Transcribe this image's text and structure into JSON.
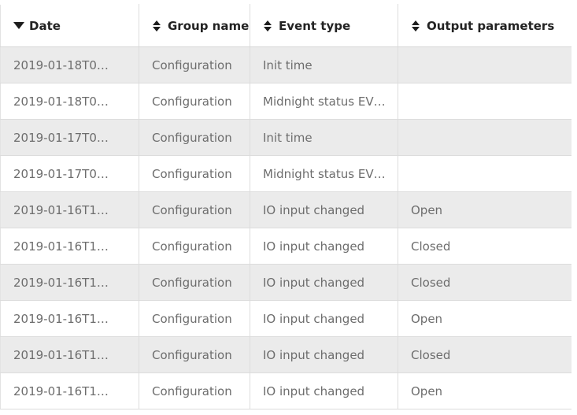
{
  "table": {
    "columns": [
      {
        "label": "Date",
        "sort": "desc",
        "icon": "sort-descending-icon"
      },
      {
        "label": "Group name",
        "sort": "none",
        "icon": "sort-none-icon"
      },
      {
        "label": "Event type",
        "sort": "none",
        "icon": "sort-none-icon"
      },
      {
        "label": "Output parameters",
        "sort": "none",
        "icon": "sort-none-icon"
      }
    ],
    "rows": [
      {
        "date": "2019-01-18T0…",
        "group": "Configuration",
        "event": "Init time",
        "output": ""
      },
      {
        "date": "2019-01-18T0…",
        "group": "Configuration",
        "event": "Midnight status EV…",
        "output": ""
      },
      {
        "date": "2019-01-17T0…",
        "group": "Configuration",
        "event": "Init time",
        "output": ""
      },
      {
        "date": "2019-01-17T0…",
        "group": "Configuration",
        "event": "Midnight status EV…",
        "output": ""
      },
      {
        "date": "2019-01-16T1…",
        "group": "Configuration",
        "event": "IO input changed",
        "output": "Open"
      },
      {
        "date": "2019-01-16T1…",
        "group": "Configuration",
        "event": "IO input changed",
        "output": "Closed"
      },
      {
        "date": "2019-01-16T1…",
        "group": "Configuration",
        "event": "IO input changed",
        "output": "Closed"
      },
      {
        "date": "2019-01-16T1…",
        "group": "Configuration",
        "event": "IO input changed",
        "output": "Open"
      },
      {
        "date": "2019-01-16T1…",
        "group": "Configuration",
        "event": "IO input changed",
        "output": "Closed"
      },
      {
        "date": "2019-01-16T1…",
        "group": "Configuration",
        "event": "IO input changed",
        "output": "Open"
      }
    ]
  },
  "colors": {
    "row_alt_background": "#ebebeb",
    "row_background": "#ffffff",
    "cell_text": "#6d6d6d",
    "header_text": "#232323",
    "border": "#dddddd"
  }
}
